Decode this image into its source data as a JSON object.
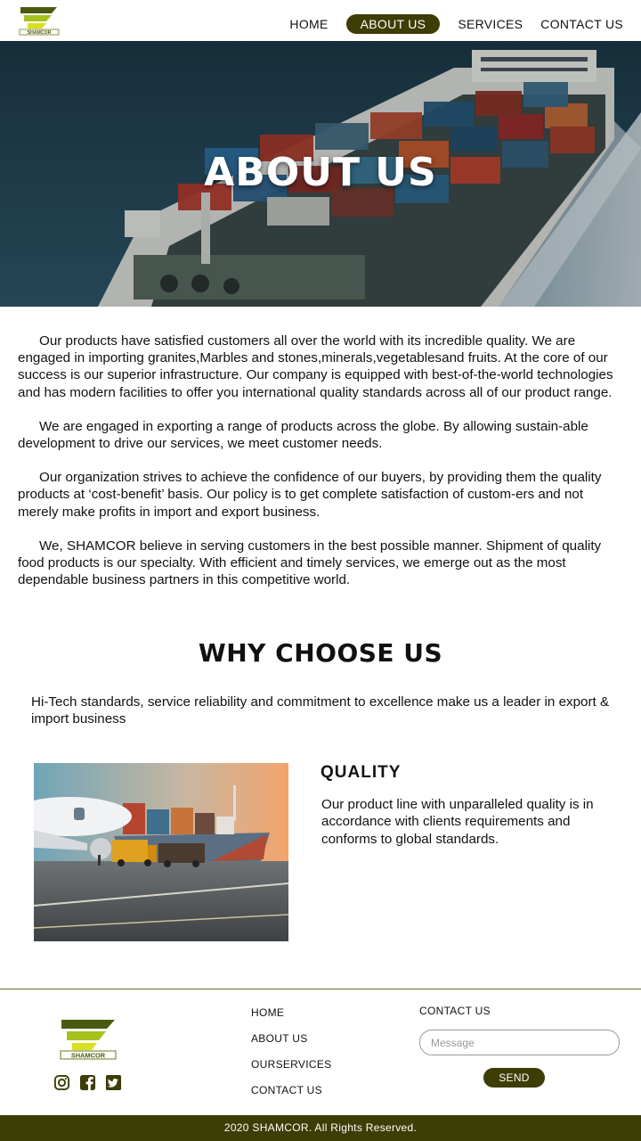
{
  "brand": {
    "name": "SHAMCOR",
    "accent": "#3d3d06",
    "logo_yellow": "#d9e021",
    "logo_green": "#7a9a1c"
  },
  "nav": {
    "items": [
      {
        "label": "HOME",
        "active": false
      },
      {
        "label": "ABOUT US",
        "active": true
      },
      {
        "label": "SERVICES",
        "active": false
      },
      {
        "label": "CONTACT US",
        "active": false
      }
    ]
  },
  "hero": {
    "title": "ABOUT US"
  },
  "about": {
    "paragraphs": [
      "Our products have satisfied customers all over the world with its incredible quality. We are engaged in importing granites,Marbles and stones,minerals,vegetablesand fruits. At the core of our success is our superior infrastructure. Our company is equipped with best-of-the-world technologies and has modern facilities to offer you international quality standards across all of our product range.",
      "We are engaged in exporting a range of  products across the globe. By allowing sustain-able development to drive our services, we meet customer needs.",
      "Our organization strives to achieve the confidence of our buyers, by providing them the quality products at ‘cost-benefit’ basis. Our policy is to get complete satisfaction of custom-ers and not merely make profits in import and export business.",
      "We, SHAMCOR believe in serving customers in the best possible manner. Shipment of quality food products is our specialty. With efficient and timely services, we emerge out as the most dependable business partners in this competitive world."
    ]
  },
  "why": {
    "title": "WHY CHOOSE US",
    "text": "Hi-Tech standards, service reliability and commitment to excellence make us a leader in export & import business"
  },
  "quality": {
    "title": "QUALITY",
    "text": "Our product line with unparalleled quality is in accordance with clients requirements and conforms to global standards."
  },
  "footer": {
    "links": [
      "HOME",
      "ABOUT US",
      "OURSERVICES",
      "CONTACT US"
    ],
    "contact_heading": "CONTACT US",
    "message_placeholder": "Message",
    "send_label": "SEND",
    "social_icons": [
      "instagram-icon",
      "facebook-icon",
      "twitter-icon"
    ],
    "copyright": "2020 SHAMCOR. All Rights Reserved."
  }
}
